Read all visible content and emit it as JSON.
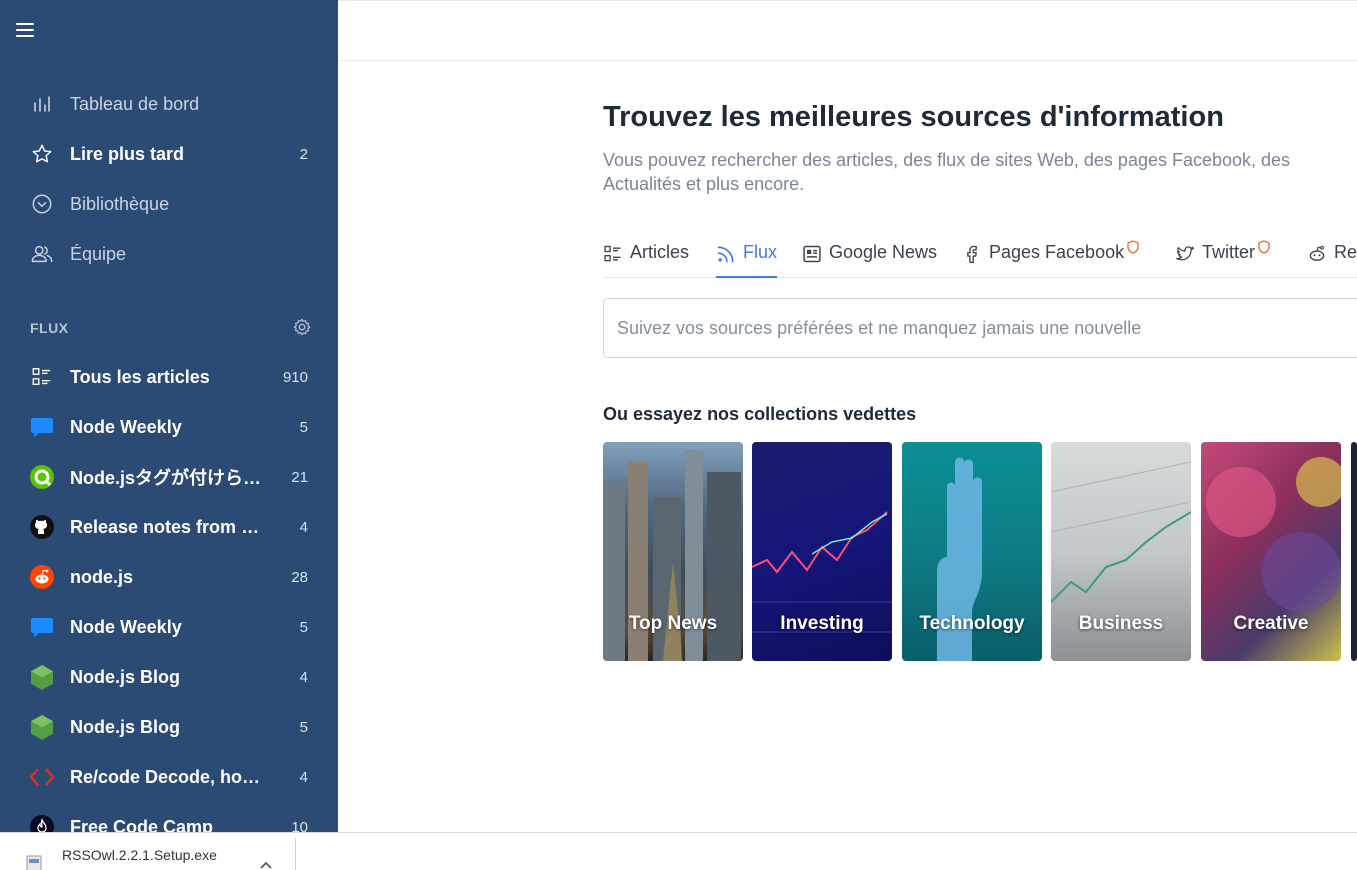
{
  "sidebar": {
    "nav": [
      {
        "label": "Tableau de bord",
        "icon": "bar-chart-icon",
        "count": ""
      },
      {
        "label": "Lire plus tard",
        "icon": "star-icon",
        "count": "2"
      },
      {
        "label": "Bibliothèque",
        "icon": "chevron-circle-icon",
        "count": ""
      },
      {
        "label": "Équipe",
        "icon": "users-icon",
        "count": ""
      }
    ],
    "section_title": "FLUX",
    "feeds": [
      {
        "label": "Tous les articles",
        "icon": "list-icon",
        "count": "910"
      },
      {
        "label": "Node Weekly",
        "icon": "chat-bubble-icon",
        "count": "5"
      },
      {
        "label": "Node.jsタグが付けられ...",
        "icon": "qiita-icon",
        "count": "21"
      },
      {
        "label": "Release notes from node",
        "icon": "github-icon",
        "count": "4"
      },
      {
        "label": "node.js",
        "icon": "reddit-icon",
        "count": "28"
      },
      {
        "label": "Node Weekly",
        "icon": "chat-bubble-icon",
        "count": "5"
      },
      {
        "label": "Node.js Blog",
        "icon": "nodejs-hexagon-icon",
        "count": "4"
      },
      {
        "label": "Node.js Blog",
        "icon": "nodejs-hexagon-icon",
        "count": "5"
      },
      {
        "label": "Re/code Decode, hoste...",
        "icon": "code-brackets-icon",
        "count": "4"
      },
      {
        "label": "Free Code Camp",
        "icon": "fire-icon",
        "count": "10"
      }
    ]
  },
  "main": {
    "title": "Trouvez les meilleures sources d'information",
    "description": "Vous pouvez rechercher des articles, des flux de sites Web, des pages Facebook, des Actualités et plus encore.",
    "tabs": [
      {
        "label": "Articles",
        "icon": "articles-icon"
      },
      {
        "label": "Flux",
        "icon": "rss-icon"
      },
      {
        "label": "Google News",
        "icon": "newspaper-icon"
      },
      {
        "label": "Pages Facebook",
        "icon": "facebook-icon"
      },
      {
        "label": "Twitter",
        "icon": "twitter-icon"
      },
      {
        "label": "Re",
        "icon": "reddit-icon"
      }
    ],
    "active_tab": "Flux",
    "search_placeholder": "Suivez vos sources préférées et ne manquez jamais une nouvelle",
    "collections_title": "Ou essayez nos collections vedettes",
    "collections": [
      {
        "label": "Top News"
      },
      {
        "label": "Investing"
      },
      {
        "label": "Technology"
      },
      {
        "label": "Business"
      },
      {
        "label": "Creative"
      }
    ]
  },
  "download": {
    "filename": "RSSOwl.2.2.1.Setup.exe"
  },
  "colors": {
    "sidebar_bg": "#2b4a74",
    "accent": "#3b7dd8",
    "premium_shield": "#e8763a"
  }
}
